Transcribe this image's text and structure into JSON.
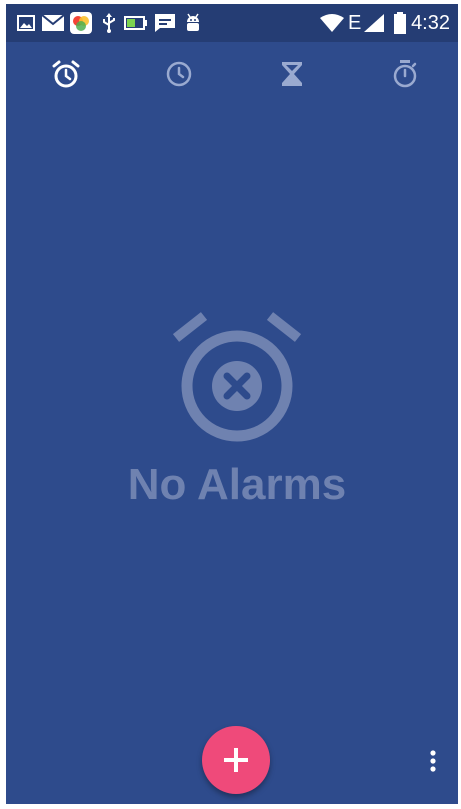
{
  "status_bar": {
    "time": "4:32",
    "network_type": "E",
    "notification_icons": [
      "image-icon",
      "mail-icon",
      "app-icon",
      "usb-icon",
      "battery-charging-icon",
      "chat-icon",
      "android-debug-icon"
    ],
    "system_icons": [
      "wifi-icon",
      "signal-icon",
      "battery-icon"
    ]
  },
  "tabs": [
    {
      "name": "alarm",
      "icon": "alarm-clock-icon",
      "selected": true
    },
    {
      "name": "clock",
      "icon": "clock-icon",
      "selected": false
    },
    {
      "name": "timer",
      "icon": "hourglass-icon",
      "selected": false
    },
    {
      "name": "stopwatch",
      "icon": "stopwatch-icon",
      "selected": false
    }
  ],
  "empty_state": {
    "icon": "alarm-off-icon",
    "message": "No Alarms"
  },
  "fab": {
    "icon": "plus-icon"
  },
  "menu": {
    "icon": "more-vert-icon"
  },
  "colors": {
    "background": "#2e4b8c",
    "status_bar": "#253d74",
    "fab": "#ef4a7a",
    "muted_text": "#6f82b0"
  }
}
